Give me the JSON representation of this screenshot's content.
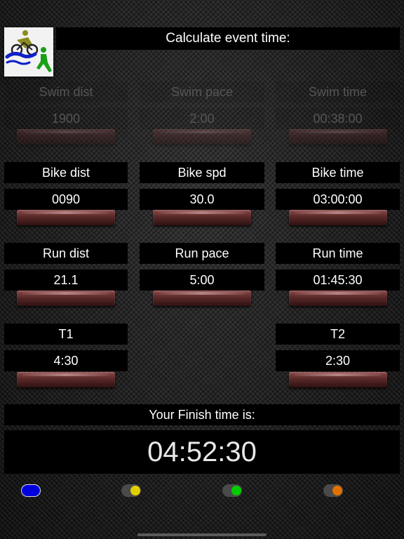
{
  "status": {
    "text": ""
  },
  "title": "Calculate event time:",
  "swim": {
    "dist_label": "Swim dist",
    "pace_label": "Swim pace",
    "time_label": "Swim time",
    "dist_value": "1900",
    "pace_value": "2:00",
    "time_value": "00:38:00"
  },
  "bike": {
    "dist_label": "Bike dist",
    "pace_label": "Bike spd",
    "time_label": "Bike time",
    "dist_value": "0090",
    "pace_value": "30.0",
    "time_value": "03:00:00"
  },
  "run": {
    "dist_label": "Run dist",
    "pace_label": "Run pace",
    "time_label": "Run time",
    "dist_value": "21.1",
    "pace_value": "5:00",
    "time_value": "01:45:30"
  },
  "transitions": {
    "t1_label": "T1",
    "t1_value": "4:30",
    "t2_label": "T2",
    "t2_value": "2:30"
  },
  "finish": {
    "label": "Your Finish time is:",
    "value": "04:52:30"
  },
  "toggles": [
    {
      "name": "blue",
      "color": "#0000dd",
      "on": true
    },
    {
      "name": "yellow",
      "color": "#e0d000",
      "on": false
    },
    {
      "name": "green",
      "color": "#00cc00",
      "on": false
    },
    {
      "name": "orange",
      "color": "#e07000",
      "on": false
    }
  ]
}
